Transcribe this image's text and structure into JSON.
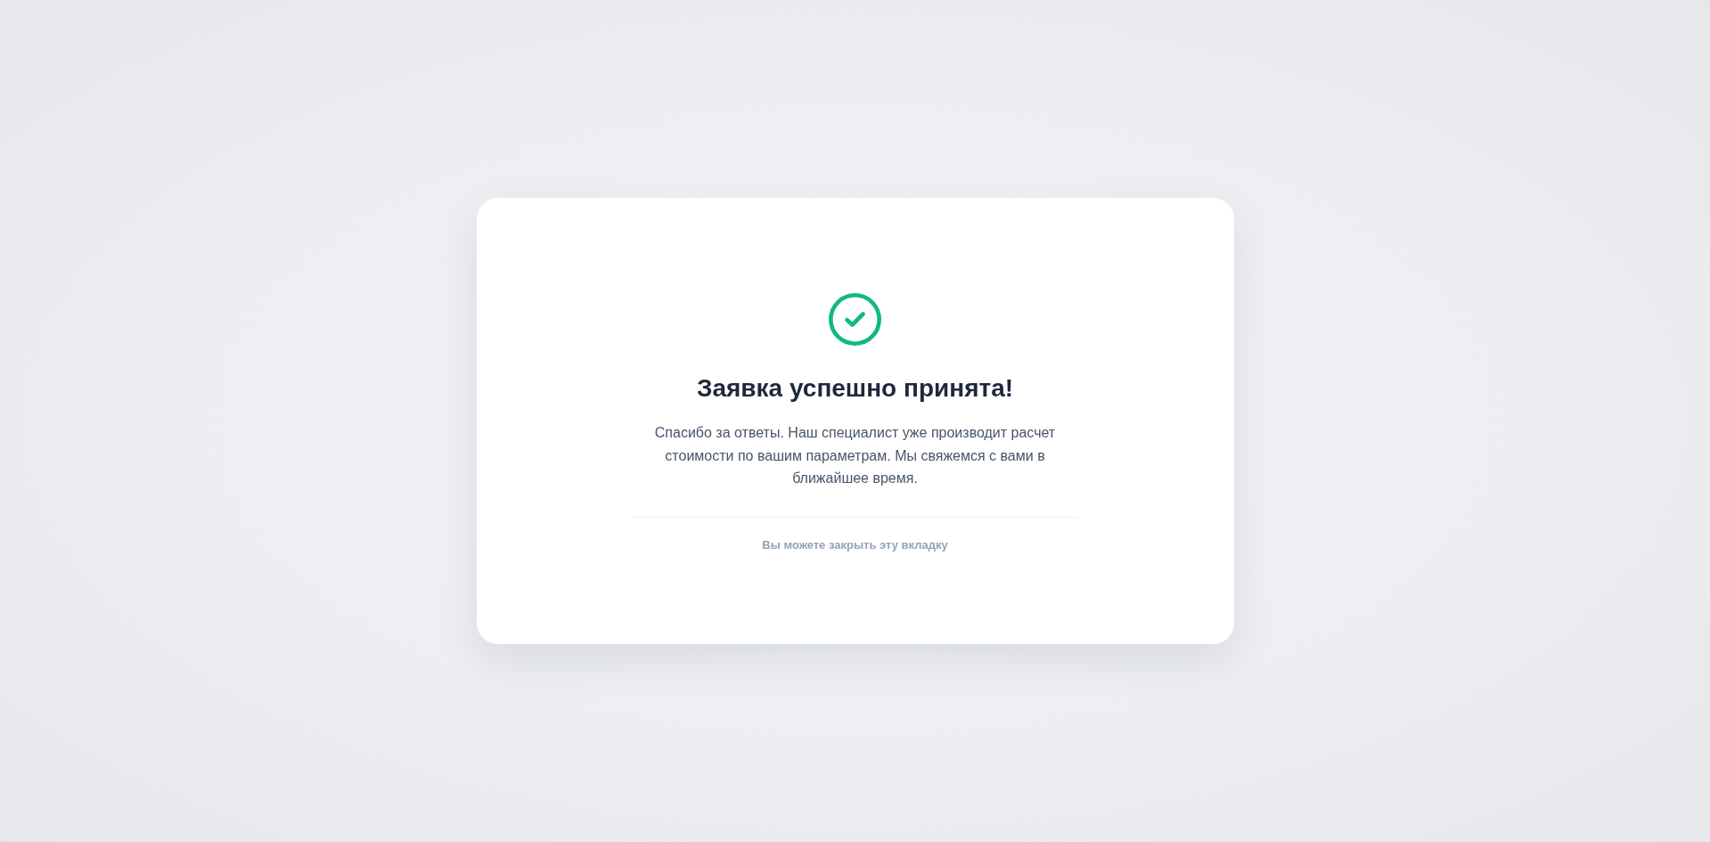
{
  "card": {
    "title": "Заявка успешно принята!",
    "message": "Спасибо за ответы. Наш специалист уже производит расчет стоимости по вашим параметрам. Мы свяжемся с вами в ближайшее время.",
    "note": "Вы можете закрыть эту вкладку"
  }
}
